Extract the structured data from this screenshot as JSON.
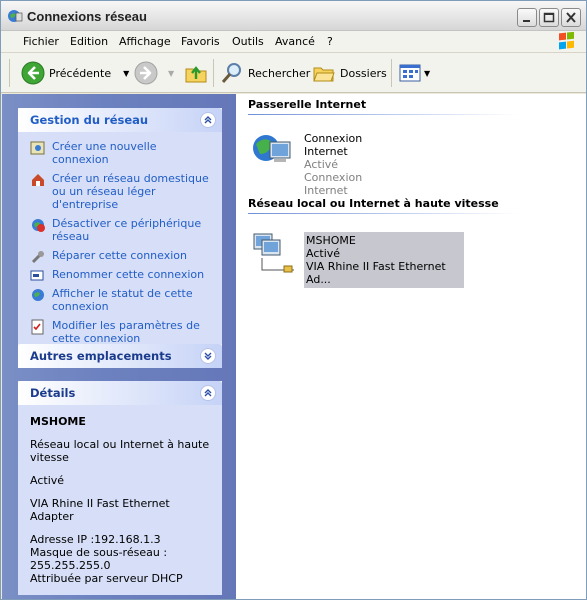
{
  "window": {
    "title": "Connexions réseau"
  },
  "menu": [
    "Fichier",
    "Edition",
    "Affichage",
    "Favoris",
    "Outils",
    "Avancé",
    "?"
  ],
  "toolbar": {
    "back_label": "Précédente",
    "search_label": "Rechercher",
    "folders_label": "Dossiers"
  },
  "left": {
    "network_tasks": {
      "title": "Gestion du réseau",
      "items": [
        "Créer une nouvelle connexion",
        "Créer un réseau domestique ou un réseau léger d'entreprise",
        "Désactiver ce périphérique réseau",
        "Réparer cette connexion",
        "Renommer cette connexion",
        "Afficher le statut de cette connexion",
        "Modifier les paramètres de cette connexion"
      ]
    },
    "other_places": {
      "title": "Autres emplacements"
    },
    "details": {
      "title": "Détails",
      "name": "MSHOME",
      "type": "Réseau local ou Internet à haute vitesse",
      "status": "Activé",
      "adapter": "VIA Rhine II Fast Ethernet Adapter",
      "ip": "Adresse IP :192.168.1.3",
      "mask_label": "Masque de sous-réseau :",
      "mask": "255.255.255.0",
      "assigned": "Attribuée par serveur DHCP"
    }
  },
  "right": {
    "gateway_group": "Passerelle Internet",
    "gateway_item": {
      "name": "Connexion Internet",
      "status": "Activé",
      "type": "Connexion Internet"
    },
    "lan_group": "Réseau local ou Internet à haute vitesse",
    "lan_item": {
      "name": "MSHOME",
      "status": "Activé",
      "device": "VIA Rhine II Fast Ethernet Ad..."
    }
  }
}
